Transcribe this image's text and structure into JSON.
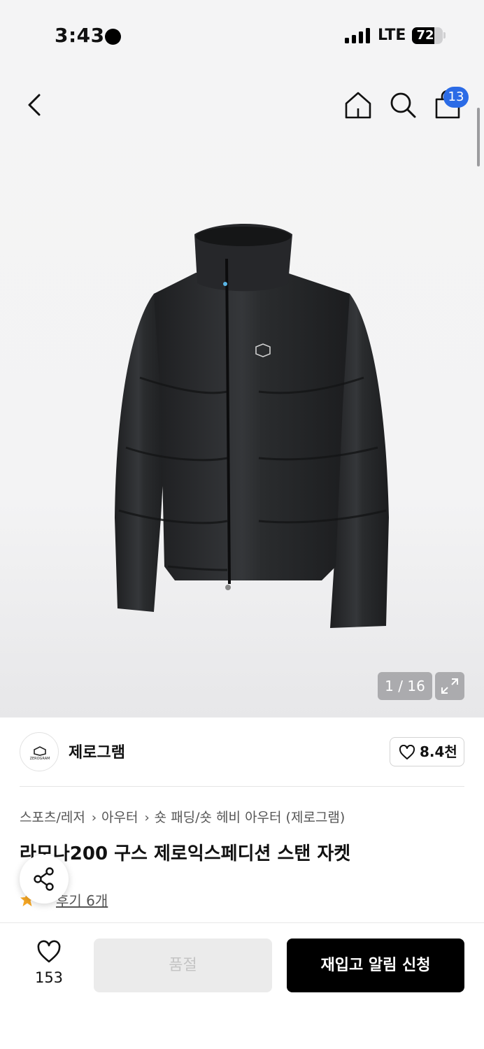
{
  "status_bar": {
    "time": "3:43",
    "network": "LTE",
    "battery": "72",
    "battery_level": 0.72
  },
  "nav": {
    "back_icon": "chevron-left-icon",
    "home_icon": "home-icon",
    "search_icon": "search-icon",
    "cart_icon": "shopping-bag-icon",
    "cart_count": "13",
    "badge_color": "#2b6be6"
  },
  "gallery": {
    "counter": "1 / 16",
    "expand_icon": "expand-icon"
  },
  "brand": {
    "logo_text": "ZEROGRAM",
    "name": "제로그램",
    "likes": "8.4천"
  },
  "breadcrumb": [
    "스포츠/레저",
    "아우터",
    "숏 패딩/숏 헤비 아우터 (제로그램)"
  ],
  "product": {
    "title": "라모나200 구스 제로익스페디션 스탠 자켓",
    "rating": "5",
    "review_link": "후기 6개",
    "rating_color": "#f5a623"
  },
  "bottom_bar": {
    "wish_count": "153",
    "soldout_label": "품절",
    "restock_label": "재입고 알림 신청"
  }
}
